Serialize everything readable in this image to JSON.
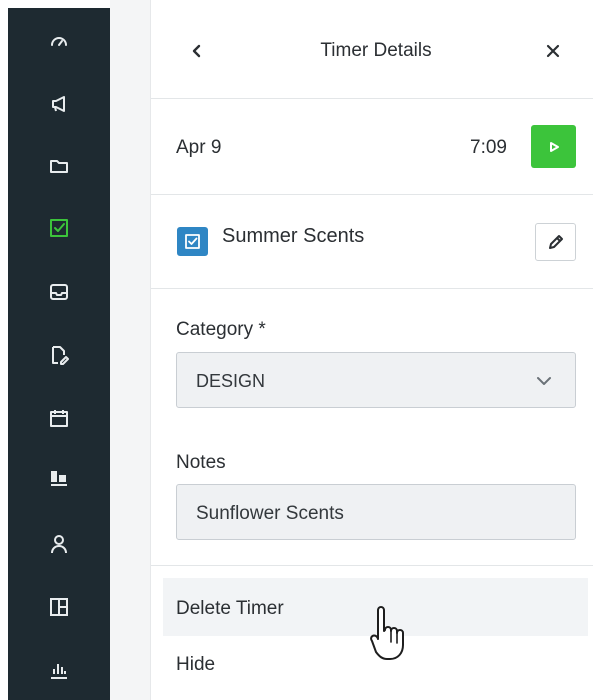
{
  "sidebar": {
    "items": [
      {
        "icon": "gauge-icon",
        "active": false
      },
      {
        "icon": "megaphone-icon",
        "active": false
      },
      {
        "icon": "folder-icon",
        "active": false
      },
      {
        "icon": "checkbox-icon",
        "active": true
      },
      {
        "icon": "inbox-icon",
        "active": false
      },
      {
        "icon": "document-edit-icon",
        "active": false
      },
      {
        "icon": "calendar-icon",
        "active": false
      },
      {
        "icon": "workload-icon",
        "active": false
      },
      {
        "icon": "person-icon",
        "active": false
      },
      {
        "icon": "layout-icon",
        "active": false
      },
      {
        "icon": "bar-chart-icon",
        "active": false
      }
    ],
    "active_color": "#3cc43b",
    "icon_color": "#e8ecee",
    "background": "#1e2a31"
  },
  "header": {
    "title": "Timer Details",
    "back_icon": "chevron-left-icon",
    "close_icon": "close-icon"
  },
  "timer": {
    "date": "Apr 9",
    "duration": "7:09",
    "play_icon": "play-icon",
    "play_color": "#3cc43b"
  },
  "task": {
    "name": "Summer Scents",
    "check_color": "#2f86c4",
    "edit_icon": "pencil-icon"
  },
  "category": {
    "label": "Category *",
    "value": "DESIGN"
  },
  "notes": {
    "label": "Notes",
    "value": "Sunflower Scents"
  },
  "menu": {
    "delete_label": "Delete Timer",
    "hide_label": "Hide"
  }
}
